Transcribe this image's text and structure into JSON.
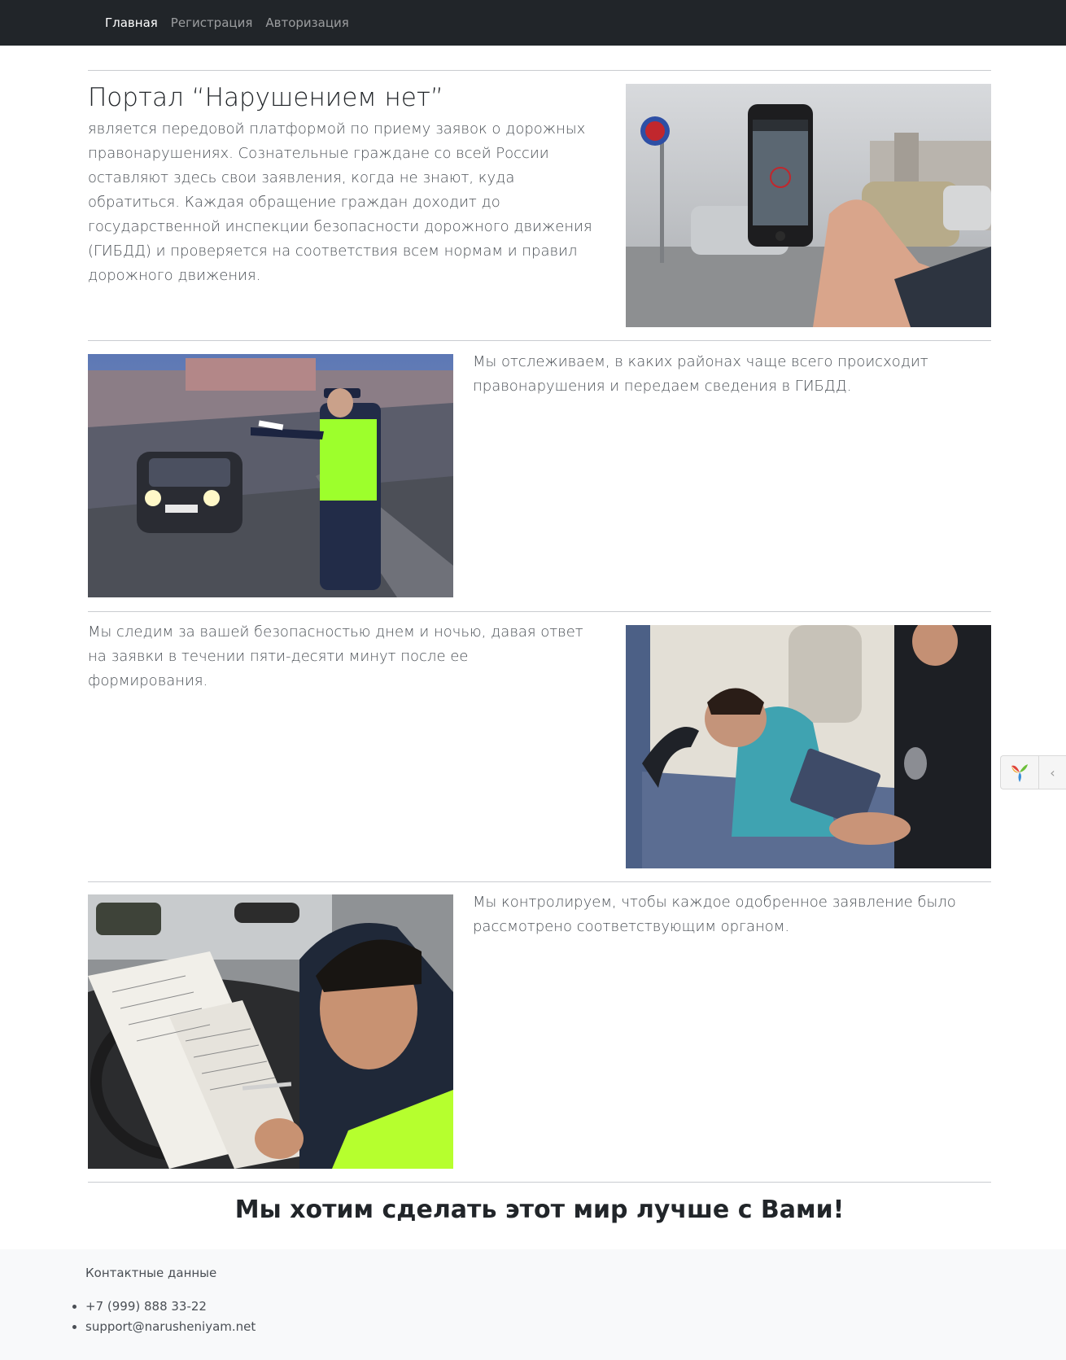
{
  "navbar": {
    "links": [
      {
        "label": "Главная",
        "active": true
      },
      {
        "label": "Регистрация",
        "active": false
      },
      {
        "label": "Авторизация",
        "active": false
      }
    ]
  },
  "intro": {
    "title": "Портал “Нарушением нет”",
    "text": "является передовой платформой по приему заявок о дорожных правонарушениях. Сознательные граждане со всей России оставляют здесь свои заявления, когда не знают, куда обратиться. Каждая обращение граждан доходит до государственной инспекции безопасности дорожного движения (ГИБДД) и проверяется на соответствия всем нормам и правил дорожного движения."
  },
  "sections": [
    {
      "text": "Мы отслеживаем, в каких районах чаще всего происходит правонарушения и передаем сведения в ГИБДД."
    },
    {
      "text": "Мы следим за вашей безопасностью днем и ночью, давая ответ на заявки в течении пяти-десяти минут после ее формирования."
    },
    {
      "text": "Мы контролируем, чтобы каждое одобренное заявление было рассмотрено соответствующим органом."
    }
  ],
  "slogan": "Мы хотим сделать этот мир лучше с Вами!",
  "footer": {
    "title": "Контактные данные",
    "phone": "+7 (999) 888 33-22",
    "email": "support@narusheniyam.net"
  },
  "debug_toolbar": {
    "logo_icon": "yii-logo-icon",
    "toggle_icon": "chevron-left-icon"
  },
  "colors": {
    "navbar_bg": "#212529",
    "footer_bg": "#f8f9fa",
    "accent_green": "#b6ff2e"
  }
}
